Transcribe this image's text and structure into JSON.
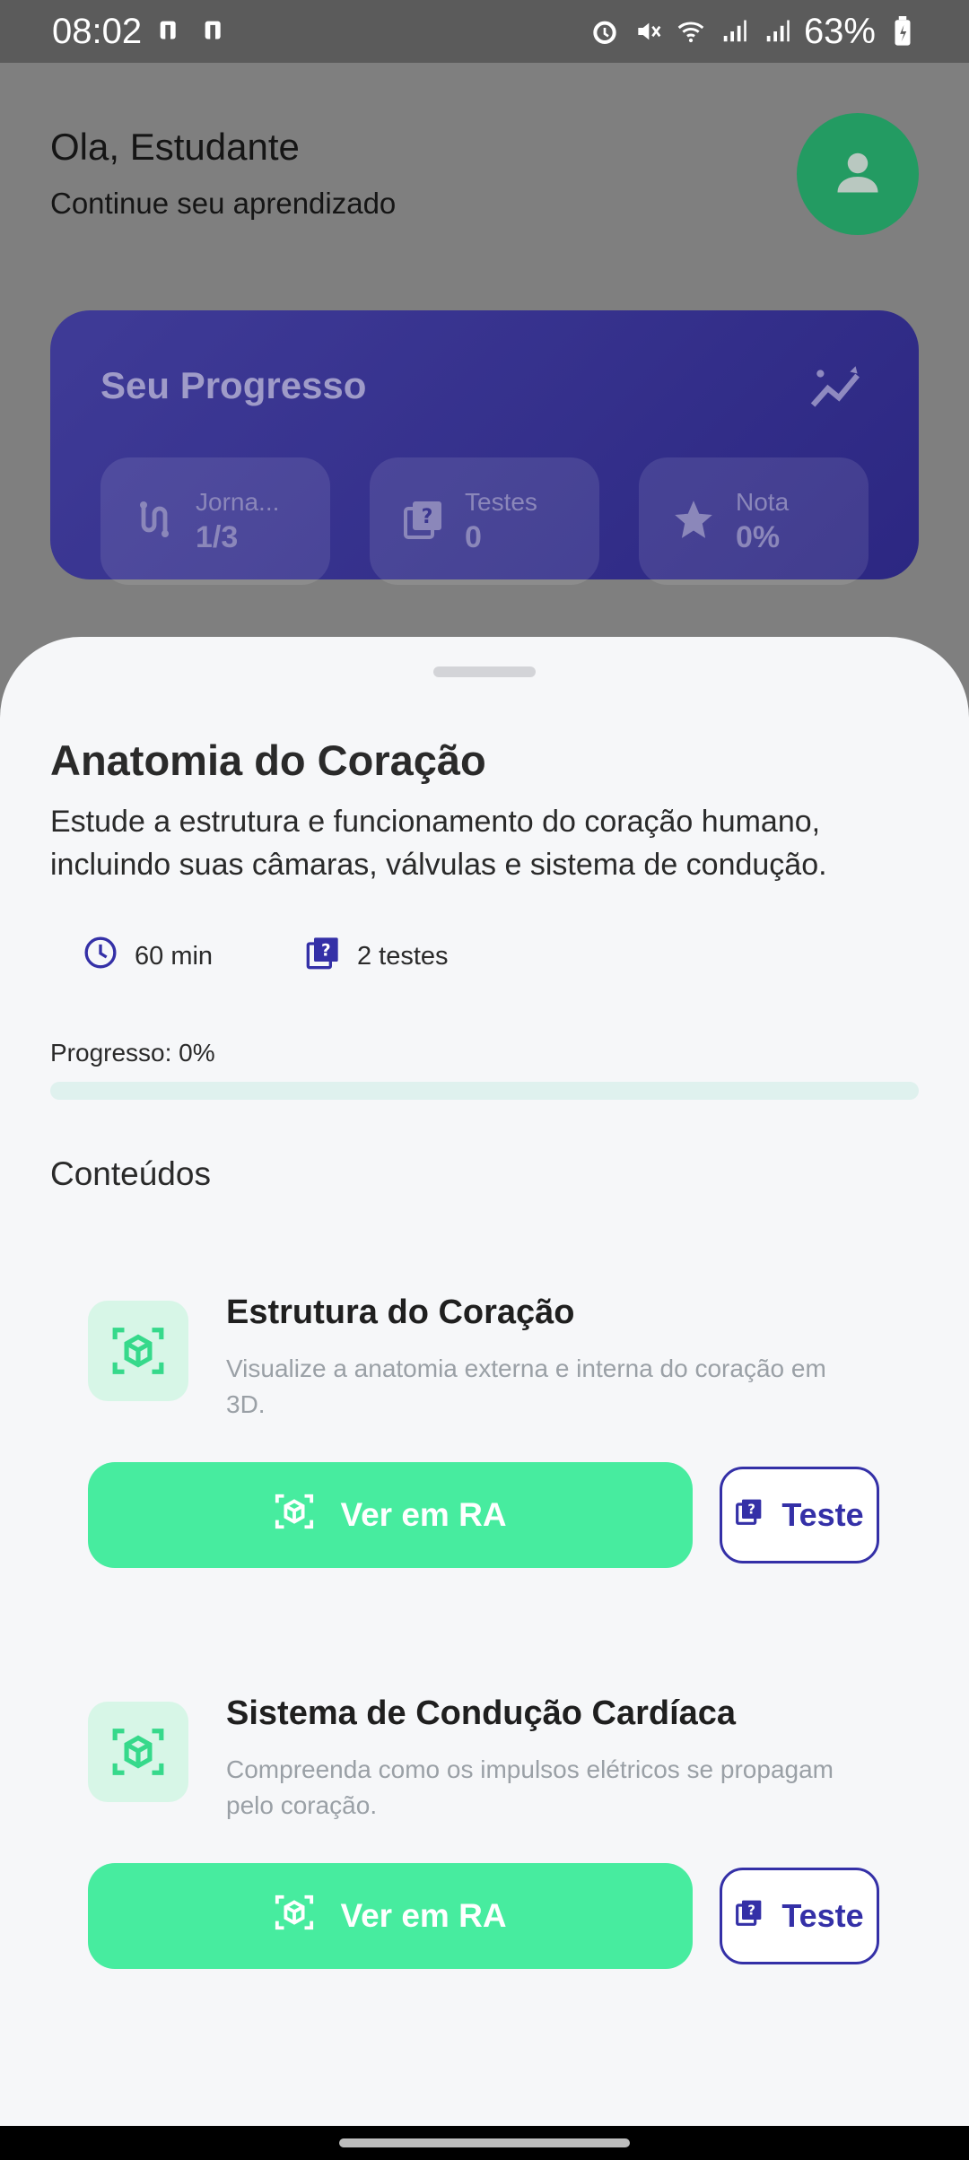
{
  "status_bar": {
    "time": "08:02",
    "battery": "63%",
    "icons": [
      "notification-icon",
      "notification-icon",
      "alarm-icon",
      "mute-icon",
      "wifi-icon",
      "signal-icon",
      "signal-icon",
      "battery-icon"
    ]
  },
  "header": {
    "greeting": "Ola, Estudante",
    "subtitle": "Continue seu aprendizado",
    "avatar_icon": "person-icon"
  },
  "progress_card": {
    "title": "Seu Progresso",
    "icon": "trending-icon",
    "stats": [
      {
        "label": "Jorna...",
        "value": "1/3",
        "icon": "route-icon"
      },
      {
        "label": "Testes",
        "value": "0",
        "icon": "quiz-icon"
      },
      {
        "label": "Nota",
        "value": "0%",
        "icon": "star-icon"
      }
    ]
  },
  "sheet": {
    "title": "Anatomia do Coração",
    "description": "Estude a estrutura e funcionamento do coração humano, incluindo suas câmaras, válvulas e sistema de condução.",
    "duration": "60 min",
    "tests": "2 testes",
    "progress_label": "Progresso: 0%",
    "progress_value": 0,
    "contents_title": "Conteúdos",
    "contents": [
      {
        "title": "Estrutura do Coração",
        "description": "Visualize a anatomia externa e interna do coração em 3D.",
        "ar_button": "Ver em RA",
        "test_button": "Teste"
      },
      {
        "title": "Sistema de Condução Cardíaca",
        "description": "Compreenda como os impulsos elétricos se propagam pelo coração.",
        "ar_button": "Ver em RA",
        "test_button": "Teste"
      }
    ]
  },
  "colors": {
    "accent_green": "#47ec9f",
    "brand_indigo": "#3430a7",
    "avatar_green": "#239b62"
  }
}
